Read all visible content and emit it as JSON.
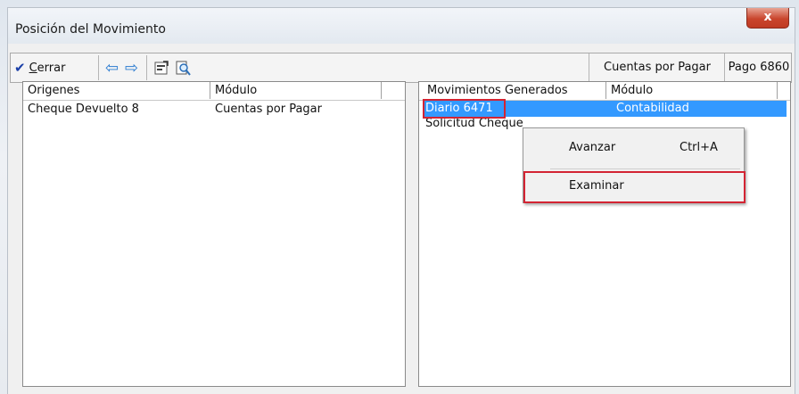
{
  "window": {
    "title": "Posición del Movimiento",
    "close_glyph": "x"
  },
  "toolbar": {
    "close_label_prefix": "",
    "close_label_underlined": "C",
    "close_label_rest": "errar",
    "check_icon": "check-icon",
    "back_icon": "arrow-left-icon",
    "forward_icon": "arrow-right-icon",
    "properties_icon": "properties-icon",
    "examine_icon": "magnifier-icon",
    "module": "Cuentas por Pagar",
    "reference": "Pago 6860"
  },
  "left_panel": {
    "columns": [
      "Origenes",
      "Módulo"
    ],
    "rows": [
      {
        "name": "Cheque Devuelto 8",
        "module": "Cuentas por Pagar"
      }
    ]
  },
  "right_panel": {
    "columns": [
      "Movimientos Generados",
      "Módulo"
    ],
    "rows": [
      {
        "name": "Diario 6471",
        "module": "Contabilidad",
        "selected": true
      },
      {
        "name": "Solicitud Cheque",
        "module": ""
      }
    ]
  },
  "context_menu": {
    "items": [
      {
        "label": "Avanzar",
        "shortcut": "Ctrl+A"
      },
      {
        "label": "Examinar",
        "shortcut": ""
      }
    ]
  },
  "colors": {
    "selection": "#3399ff",
    "highlight_box": "#d32433",
    "close_button": "#c9452d"
  }
}
